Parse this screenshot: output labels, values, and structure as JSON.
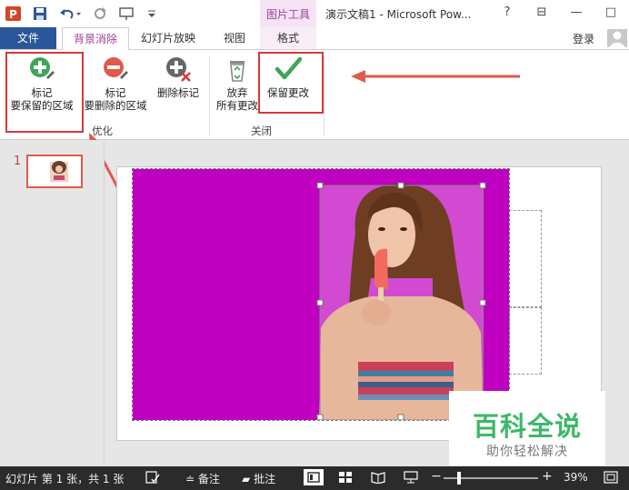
{
  "title_bar": {
    "contextual_group": "图片工具",
    "document_title": "演示文稿1 - Microsoft Pow...",
    "window_controls": {
      "help": "?",
      "ribbon_display": "⊟",
      "minimize": "—",
      "maximize": "□",
      "close": "✕"
    }
  },
  "tabs": {
    "file": "文件",
    "background_removal": "背景消除",
    "slideshow": "幻灯片放映",
    "view": "视图",
    "format": "格式",
    "login": "登录"
  },
  "ribbon": {
    "mark_keep": {
      "line1": "标记",
      "line2": "要保留的区域"
    },
    "mark_remove": {
      "line1": "标记",
      "line2": "要删除的区域"
    },
    "delete_mark": {
      "line1": "删除标记"
    },
    "discard": {
      "line1": "放弃",
      "line2": "所有更改"
    },
    "keep_changes": {
      "line1": "保留更改"
    },
    "groups": {
      "refine": "优化",
      "close": "关闭"
    }
  },
  "slides_panel": {
    "slide_number": "1"
  },
  "watermark": {
    "title": "百科全说",
    "subtitle": "助你轻松解决"
  },
  "status_bar": {
    "slide_info": "幻灯片 第 1 张，共 1 张",
    "notes": "备注",
    "comments": "批注",
    "zoom": "39%"
  },
  "colors": {
    "accent": "#a0409a",
    "file_tab": "#2b579a",
    "highlight": "#d43a3a",
    "removed_background": "#c000c0",
    "watermark": "#3db86a"
  },
  "zoom_level": 0.39
}
